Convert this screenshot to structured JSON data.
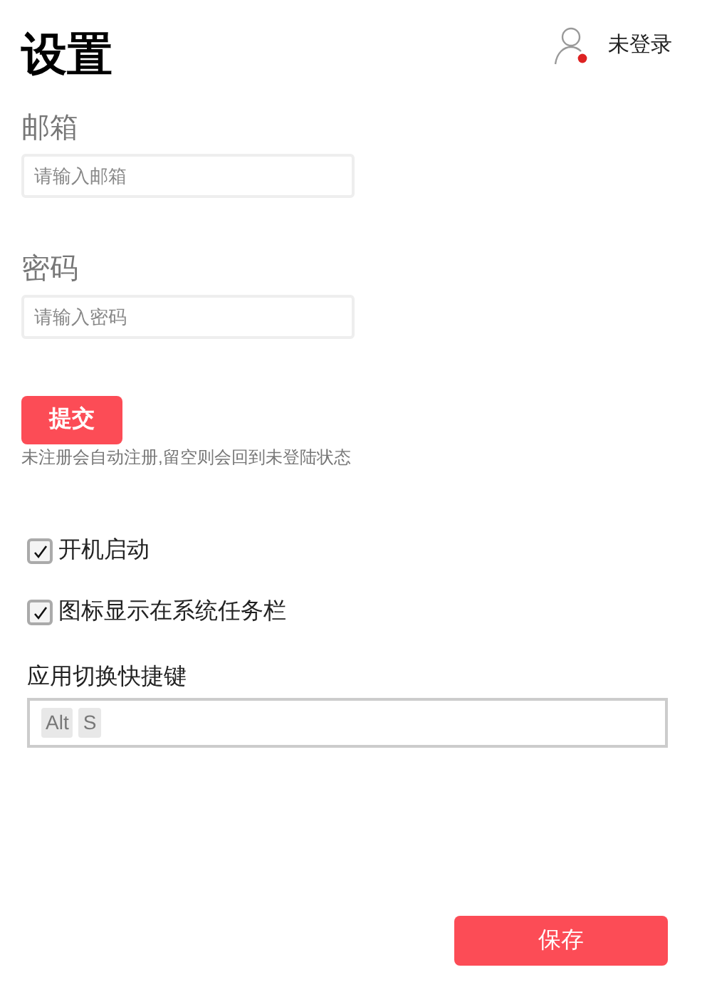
{
  "title": "设置",
  "user": {
    "status": "未登录",
    "logged_in": false
  },
  "fields": [
    {
      "label": "邮箱",
      "placeholder": "请输入邮箱"
    },
    {
      "label": "密码",
      "placeholder": "请输入密码"
    }
  ],
  "submit_button": "提交",
  "hint": "未注册会自动注册,留空则会回到未登陆状态",
  "options": [
    {
      "label": "开机启动",
      "checked": true
    },
    {
      "label": "图标显示在系统任务栏",
      "checked": true
    }
  ],
  "shortcut": {
    "label": "应用切换快捷键",
    "keys": [
      "Alt",
      "S"
    ]
  },
  "save_button": "保存"
}
